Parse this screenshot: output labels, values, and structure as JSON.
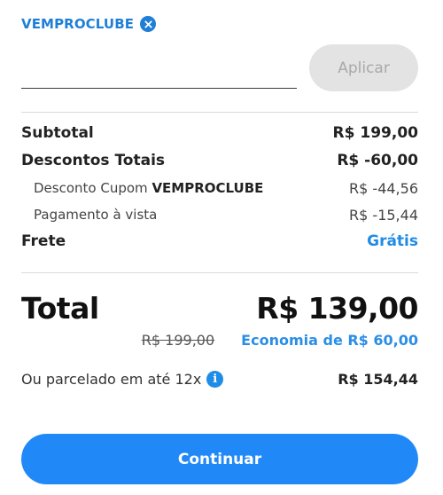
{
  "coupon": {
    "applied_code": "VEMPROCLUBE",
    "input_value": "",
    "input_placeholder": "",
    "apply_label": "Aplicar"
  },
  "summary": {
    "subtotal_label": "Subtotal",
    "subtotal_value": "R$ 199,00",
    "discounts_label": "Descontos Totais",
    "discounts_value": "R$ -60,00",
    "coupon_discount_prefix": "Desconto Cupom",
    "coupon_discount_code": "VEMPROCLUBE",
    "coupon_discount_value": "R$ -44,56",
    "cash_discount_label": "Pagamento à vista",
    "cash_discount_value": "R$ -15,44",
    "shipping_label": "Frete",
    "shipping_value": "Grátis"
  },
  "total": {
    "label": "Total",
    "value": "R$ 139,00",
    "old_price": "R$ 199,00",
    "savings": "Economia de R$ 60,00"
  },
  "installments": {
    "label": "Ou parcelado em até 12x",
    "value": "R$ 154,44"
  },
  "actions": {
    "continue_label": "Continuar"
  },
  "colors": {
    "accent": "#2189f7",
    "link": "#1f8ce6",
    "disabled_bg": "#e3e3e3"
  }
}
